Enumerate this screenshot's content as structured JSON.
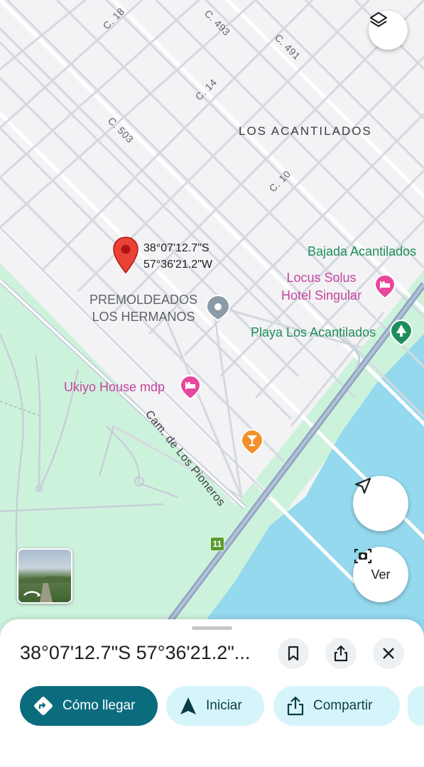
{
  "map": {
    "colors": {
      "land": "#f3f2f4",
      "green": "#cdf2dc",
      "water": "#94d9ee",
      "street": "#c9d1da",
      "highway": "#8ea3c1",
      "pin": "#ea4335"
    },
    "streets": [
      "C. 18",
      "C. 493",
      "C. 491",
      "C. 14",
      "C. 503",
      "C. 10"
    ],
    "area_label": "LOS ACANTILADOS",
    "pin_coords": {
      "lat": "38°07'12.7\"S",
      "lng": "57°36'21.2\"W"
    },
    "pois": {
      "bajada": "Bajada Acantilados",
      "locus_line1": "Locus Solus",
      "locus_line2": "Hotel Singular",
      "premold_line1": "PREMOLDEADOS",
      "premold_line2": "LOS HERMANOS",
      "playa": "Playa Los Acantilados",
      "ukiyo": "Ukiyo House mdp"
    },
    "road_label": "Cam. de Los Pioneros",
    "route_shield": "11",
    "explore_label": "Ver",
    "icons": [
      "layers-icon",
      "navigation-arrow-icon",
      "lens-camera-icon",
      "hotel-icon",
      "park-icon",
      "bar-icon",
      "place-icon",
      "street-view-icon"
    ]
  },
  "sheet": {
    "title": "38°07'12.7\"S 57°36'21.2\"...",
    "icons": [
      "bookmark-icon",
      "share-icon",
      "close-icon"
    ],
    "buttons": {
      "directions": "Cómo llegar",
      "start": "Iniciar",
      "share": "Compartir"
    }
  }
}
